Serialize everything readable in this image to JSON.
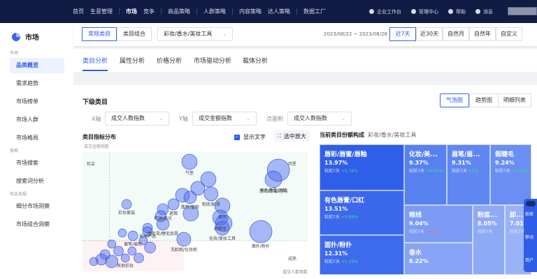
{
  "topnav": {
    "items": [
      "首页",
      "生意管理",
      "市场",
      "竞争",
      "商品策略",
      "人群策略",
      "内容策略",
      "达人策略",
      "数据工厂"
    ],
    "active": "市场",
    "right": [
      "企业工作台",
      "管理中心",
      "帮助",
      "消息"
    ]
  },
  "sidebar": {
    "title": "市场",
    "groups": [
      {
        "label": "市场",
        "items": [
          "品类概览",
          "需求趋势",
          "市场榜单",
          "市场人群",
          "市场格局"
        ]
      },
      {
        "label": "搜索",
        "items": [
          "市场搜索",
          "搜索词分析"
        ]
      },
      {
        "label": "机会发掘",
        "items": [
          "细分市场洞察",
          "市场组合洞察"
        ]
      }
    ],
    "active": "品类概览"
  },
  "filter": {
    "mode_tabs": [
      "常规类目",
      "类目组合"
    ],
    "category": "彩妆/香水/美妆工具",
    "date_range": "2023/08/22 ~ 2023/08/28",
    "periods": [
      "近7天",
      "近30天",
      "自然月",
      "自然年",
      "自定义"
    ],
    "active_period": "近7天"
  },
  "tabs": [
    "类目分析",
    "属性分析",
    "价格分析",
    "市场驱动分析",
    "载体分析"
  ],
  "section": {
    "title": "下级类目",
    "views": [
      "气泡图",
      "趋势图",
      "明细列表"
    ],
    "active_view": "气泡图",
    "x_label": "X轴",
    "x_value": "成交人数指数",
    "y_label": "Y轴",
    "y_value": "成交金额指数",
    "size_label": "点面积",
    "size_value": "成交人数指数"
  },
  "chart_data": {
    "type": "scatter",
    "title": "类目指标分布",
    "show_text_label": "显示文字",
    "zoom_label": "选中放大",
    "show_text": true,
    "xlabel": "成交人数指数",
    "ylabel": "成交金额指数",
    "xlim": [
      0,
      100
    ],
    "ylim": [
      0,
      100
    ],
    "quadrants": {
      "top_left": "机会",
      "top_right": "明星",
      "bottom_right": "成熟"
    },
    "x_mid": 45,
    "y_mid": 24,
    "points": [
      {
        "x": 47.5,
        "y": 91.6,
        "s": 11,
        "label": "气垫"
      },
      {
        "x": 87,
        "y": 84.4,
        "s": 16,
        "label": ""
      },
      {
        "x": 84.8,
        "y": 76.6,
        "s": 12,
        "label": "唇彩/唇蜜/唇釉"
      },
      {
        "x": 84.8,
        "y": 70,
        "s": 0,
        "label": "有色唇膏/口红"
      },
      {
        "x": 55.9,
        "y": 76.6,
        "s": 11,
        "label": ""
      },
      {
        "x": 51.2,
        "y": 68.9,
        "s": 10,
        "label": ""
      },
      {
        "x": 57.1,
        "y": 64.1,
        "s": 10,
        "label": "粉底液/膏"
      },
      {
        "x": 44.4,
        "y": 62.9,
        "s": 10,
        "label": ""
      },
      {
        "x": 47.8,
        "y": 61.1,
        "s": 9,
        "label": "散粉/蜜粉"
      },
      {
        "x": 40.4,
        "y": 55.1,
        "s": 8,
        "label": "遮瑕"
      },
      {
        "x": 62.1,
        "y": 53.9,
        "s": 11,
        "label": "香水"
      },
      {
        "x": 48.1,
        "y": 47.3,
        "s": 11,
        "label": ""
      },
      {
        "x": 35.7,
        "y": 50.9,
        "s": 8,
        "label": "修容/高光"
      },
      {
        "x": 34.8,
        "y": 44.9,
        "s": 8,
        "label": ""
      },
      {
        "x": 35.7,
        "y": 38.3,
        "s": 9,
        "label": "睫毛膏/睫毛底膏"
      },
      {
        "x": 61.2,
        "y": 43.7,
        "s": 11,
        "label": "假睫毛"
      },
      {
        "x": 62.7,
        "y": 38.9,
        "s": 12,
        "label": ""
      },
      {
        "x": 62.1,
        "y": 34.7,
        "s": 10,
        "label": "化妆/美妆工具"
      },
      {
        "x": 79.2,
        "y": 31.7,
        "s": 16,
        "label": "面扑/粉扑"
      },
      {
        "x": 45,
        "y": 25.1,
        "s": 10,
        "label": "洗脸刷/化妆刷"
      },
      {
        "x": 19.6,
        "y": 55.1,
        "s": 7,
        "label": "彩妆套装"
      },
      {
        "x": 28.9,
        "y": 34.7,
        "s": 7,
        "label": "美甲产品"
      },
      {
        "x": 28.9,
        "y": 31.7,
        "s": 7,
        "label": ""
      },
      {
        "x": 17.7,
        "y": 30.5,
        "s": 6,
        "label": ""
      },
      {
        "x": 22.4,
        "y": 28.1,
        "s": 7,
        "label": "眉笔/眉粉"
      },
      {
        "x": 27,
        "y": 24,
        "s": 6,
        "label": ""
      },
      {
        "x": 30,
        "y": 18,
        "s": 8,
        "label": ""
      },
      {
        "x": 13,
        "y": 21,
        "s": 6,
        "label": ""
      },
      {
        "x": 16,
        "y": 15,
        "s": 7,
        "label": ""
      },
      {
        "x": 10,
        "y": 12,
        "s": 7,
        "label": ""
      },
      {
        "x": 8.4,
        "y": 7.8,
        "s": 8,
        "label": ""
      },
      {
        "x": 13,
        "y": 6,
        "s": 9,
        "label": ""
      },
      {
        "x": 19,
        "y": 9,
        "s": 6,
        "label": "其他彩妆"
      },
      {
        "x": 25,
        "y": 9,
        "s": 7,
        "label": ""
      },
      {
        "x": 5,
        "y": 6,
        "s": 6,
        "label": ""
      },
      {
        "x": 22,
        "y": 15,
        "s": 6,
        "label": ""
      }
    ]
  },
  "treemap": {
    "title": "当前类目份额构成",
    "subtitle": "彩妆/香水/美妆工具",
    "compare_label": "较前7天",
    "cells": [
      {
        "name": "唇彩/唇蜜/唇釉",
        "share": "13.97%",
        "change": "+5.76%"
      },
      {
        "name": "有色唇膏/口红",
        "share": "13.51%",
        "change": "+0.89%"
      },
      {
        "name": "面扑/粉扑",
        "share": "12.31%",
        "change": "+1.35%"
      },
      {
        "name": "化妆/美...",
        "share": "9.37%",
        "change": "+4.61%"
      },
      {
        "name": "眉笔/眉...",
        "share": "9.31%",
        "change": "+2%"
      },
      {
        "name": "假睫毛",
        "share": "9.24%",
        "change": "+1.03%"
      },
      {
        "name": "眼线",
        "share": "9.04%",
        "change": "-3.9%"
      },
      {
        "name": "香水",
        "share": "8.22%",
        "change": ""
      },
      {
        "name": "粉底...",
        "share": "8.05%",
        "change": "+"
      },
      {
        "name": "卸...",
        "share": "7.01%",
        "change": ""
      }
    ],
    "colors": [
      "#2f5ee8",
      "#3b68ec",
      "#4672ee",
      "#5b82f0",
      "#6c8ff2",
      "#7d9cf4"
    ]
  },
  "float_widget": {
    "items": [
      "商家",
      "移动",
      "用户"
    ]
  }
}
